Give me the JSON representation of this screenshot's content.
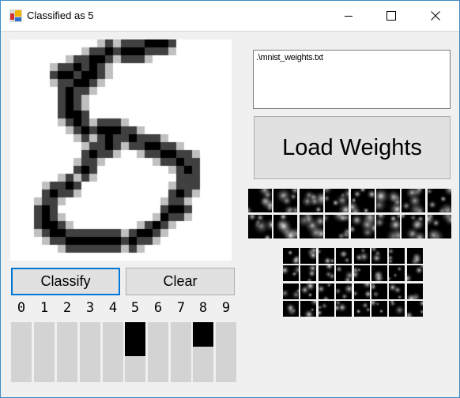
{
  "window": {
    "title": "Classified as 5",
    "icons": [
      "app-form-icon",
      "minimize-icon",
      "maximize-icon",
      "close-icon"
    ]
  },
  "canvas": {
    "palette": [
      "#ffffff",
      "#c0c0c0",
      "#404040",
      "#000000"
    ],
    "pixels": [
      "0000000000012122233320000000",
      "0000000001223233322210000000",
      "0000000122332122210000000000",
      "0000012232321000000000000000",
      "0000023323321000000000000000",
      "0000012233210000000000000000",
      "0000002322100000000000000000",
      "0000002321000000000000000000",
      "0000002321000000000000000000",
      "0000002332000000000000000000",
      "0000001232122210000000000000",
      "0000000123233322100000000000",
      "0000000012123223222100000000",
      "0000000001223212233221000000",
      "0000000002322100122332210000",
      "0000000012210000001223220000",
      "0000000023200000000012320000",
      "0000001212100000000002220000",
      "0000122320000000000012220000",
      "0000232210000000000023210000",
      "0001221000000000000122100000",
      "0002320000000000000233200000",
      "0002321000000000001322100000",
      "0002332100000000123210000000",
      "0001233222222212332100000000",
      "0000122333333323221000000000",
      "0000001222222212100000000000",
      "0000000000000000000000000000"
    ]
  },
  "weights_path": ".\\mnist_weights.txt",
  "buttons": {
    "load": "Load Weights",
    "classify": "Classify",
    "clear": "Clear"
  },
  "outputs": {
    "labels": [
      "0",
      "1",
      "2",
      "3",
      "4",
      "5",
      "6",
      "7",
      "8",
      "9"
    ],
    "values": [
      0,
      0,
      0,
      0,
      0,
      0.57,
      0,
      0,
      0.41,
      0
    ],
    "bar_color": "#d3d3d3",
    "fill_color": "#000000"
  },
  "feature_maps": {
    "layer1_count": 16,
    "layer2_count": 32
  }
}
